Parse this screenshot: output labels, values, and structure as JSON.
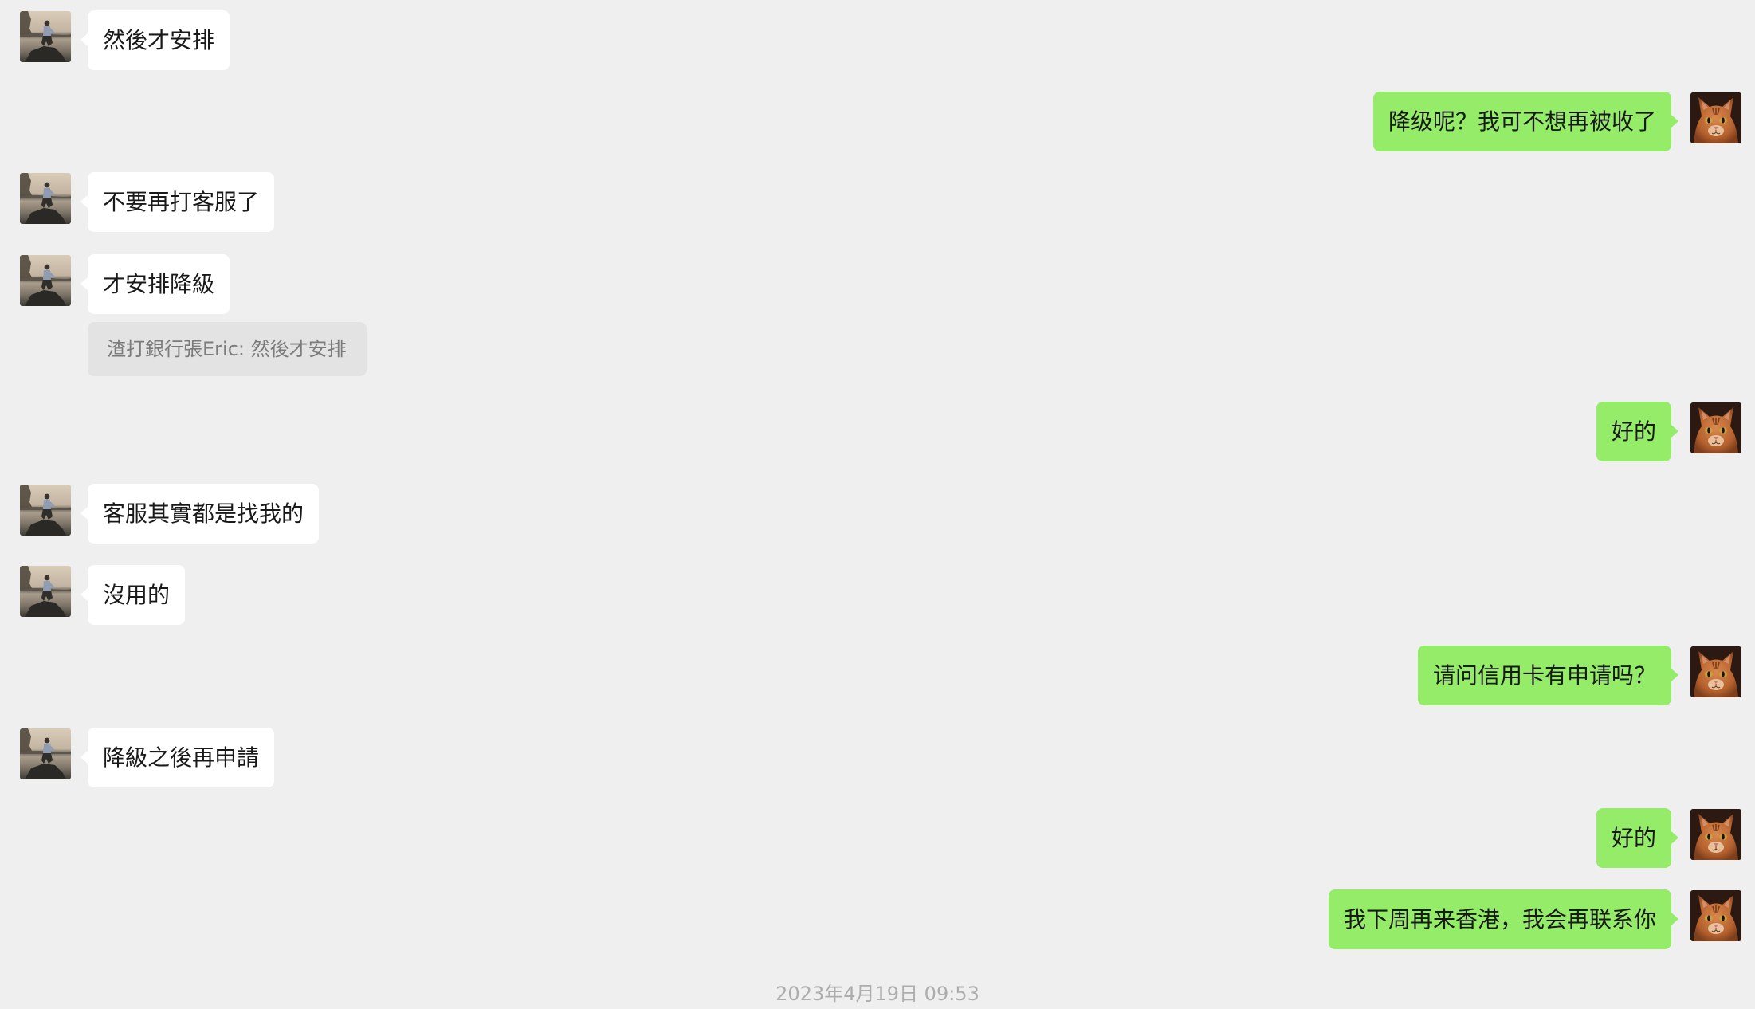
{
  "colors": {
    "background": "#efefef",
    "incoming_bubble": "#ffffff",
    "outgoing_bubble": "#95ec69",
    "quote_bubble": "#e3e3e3",
    "quote_text": "#7b7b7b",
    "timestamp_text": "#adadad"
  },
  "avatars": {
    "contact": "contact-photo-avatar",
    "self": "cat-photo-avatar"
  },
  "messages": [
    {
      "outgoing": false,
      "text": "然後才安排"
    },
    {
      "outgoing": true,
      "text": "降级呢？我可不想再被收了"
    },
    {
      "outgoing": false,
      "text": "不要再打客服了"
    },
    {
      "outgoing": false,
      "text": "才安排降級"
    },
    {
      "outgoing": true,
      "text": "好的"
    },
    {
      "outgoing": false,
      "text": "客服其實都是找我的"
    },
    {
      "outgoing": false,
      "text": "沒用的"
    },
    {
      "outgoing": true,
      "text": "请问信用卡有申请吗？"
    },
    {
      "outgoing": false,
      "text": "降級之後再申請"
    },
    {
      "outgoing": true,
      "text": "好的"
    },
    {
      "outgoing": true,
      "text": "我下周再来香港，我会再联系你"
    }
  ],
  "quote": {
    "text": "渣打銀行張Eric: 然後才安排"
  },
  "timestamp": "2023年4月19日 09:53"
}
